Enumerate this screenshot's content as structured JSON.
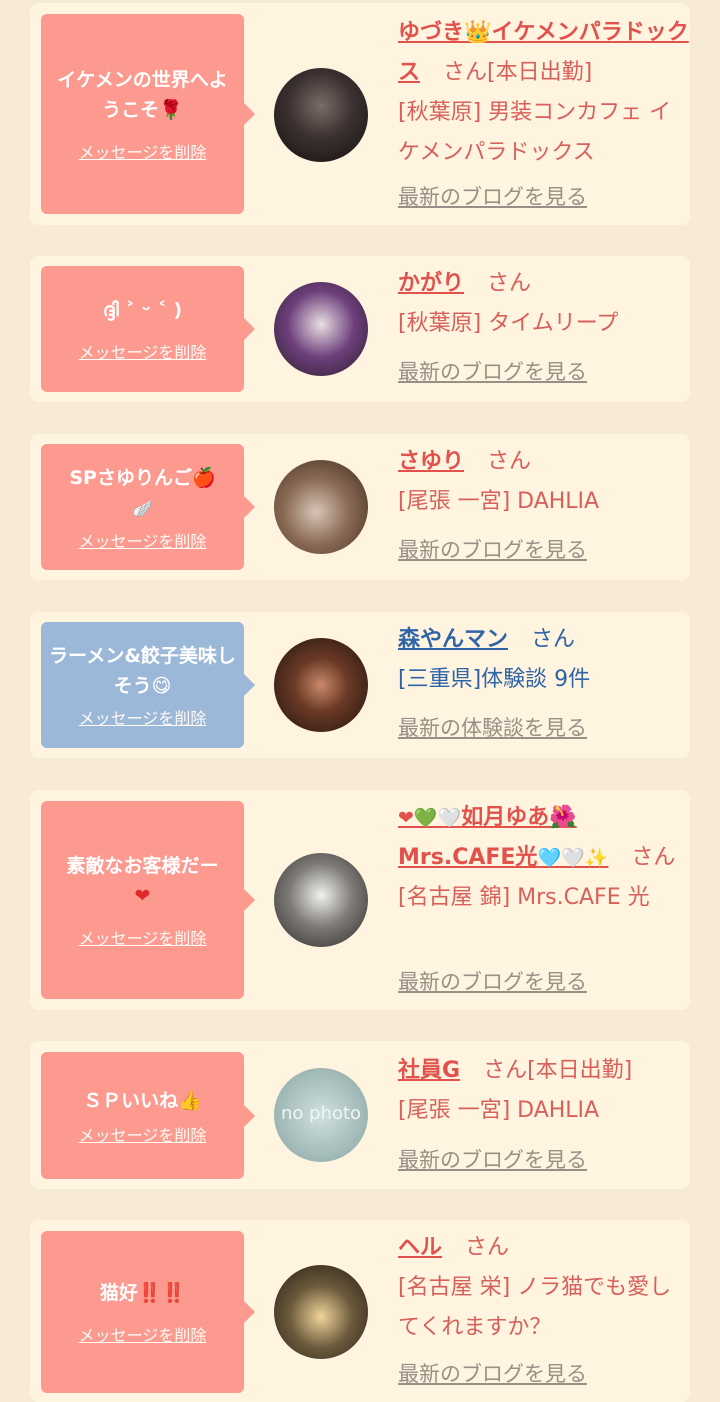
{
  "delete_label": "メッセージを削除",
  "cards": [
    {
      "message": "イケメンの世界へようこそ🌹",
      "name": "ゆづき👑イケメンパラドックス",
      "san": "さん",
      "status": "[本日出勤]",
      "shop": "[秋葉原] 男装コンカフェ イケメンパラドックス",
      "link": "最新のブログを見る"
    },
    {
      "message": "ദ്ദി ˃ ᵕ ˂ )",
      "name": "かがり",
      "san": "さん",
      "status": "",
      "shop": "[秋葉原] タイムリープ",
      "link": "最新のブログを見る"
    },
    {
      "message": "SPさゆりんご🍎",
      "message2": "🪽",
      "name": "さゆり",
      "san": "さん",
      "status": "",
      "shop": "[尾張 一宮] DAHLIA",
      "link": "最新のブログを見る"
    },
    {
      "message": "ラーメン&餃子美味しそう😋",
      "name": "森やんマン",
      "san": "さん",
      "status": "",
      "shop": "[三重県]体験談 9件",
      "link": "最新の体験談を見る"
    },
    {
      "message": "素敵なお客様だー",
      "message2": "❤",
      "name_prefix": "❤💚🤍",
      "name": "如月ゆあ🌺Mrs.CAFE光",
      "name_suffix": "🩵🤍✨",
      "san": "さん",
      "status": "",
      "shop": "[名古屋 錦] Mrs.CAFE 光",
      "link": "最新のブログを見る"
    },
    {
      "message": "ＳＰいいね👍",
      "name": "社員G",
      "san": "さん",
      "status": "[本日出勤]",
      "shop": "[尾張 一宮] DAHLIA",
      "link": "最新のブログを見る",
      "avatar_text": "no photo"
    },
    {
      "message": "猫好‼️‼️",
      "name": "ヘル",
      "san": "さん",
      "status": "",
      "shop": "[名古屋 栄] ノラ猫でも愛してくれますか？",
      "link": "最新のブログを見る"
    }
  ]
}
